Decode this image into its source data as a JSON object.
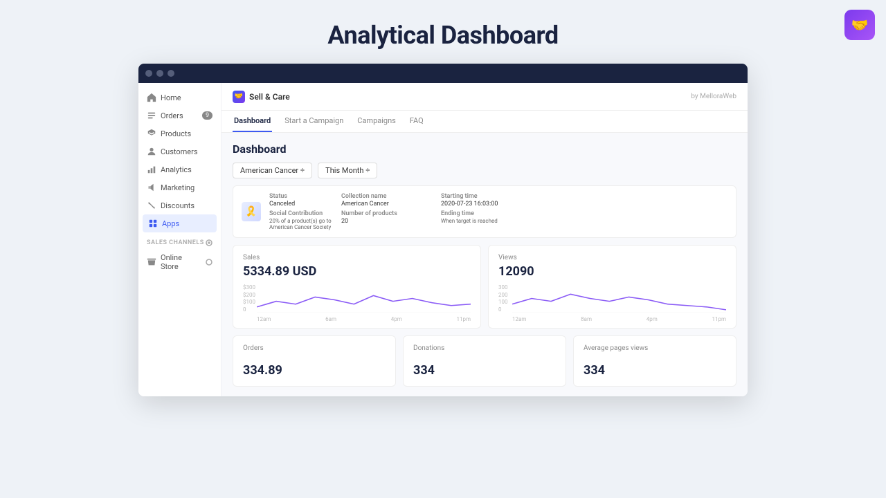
{
  "page": {
    "title": "Analytical Dashboard"
  },
  "topLogo": {
    "symbol": "🤝"
  },
  "browser": {
    "bar_color": "#1a2340"
  },
  "sidebar": {
    "nav_items": [
      {
        "id": "home",
        "label": "Home",
        "icon": "home",
        "active": false,
        "badge": null
      },
      {
        "id": "orders",
        "label": "Orders",
        "icon": "orders",
        "active": false,
        "badge": "9"
      },
      {
        "id": "products",
        "label": "Products",
        "icon": "products",
        "active": false,
        "badge": null
      },
      {
        "id": "customers",
        "label": "Customers",
        "icon": "customers",
        "active": false,
        "badge": null
      },
      {
        "id": "analytics",
        "label": "Analytics",
        "icon": "analytics",
        "active": false,
        "badge": null
      },
      {
        "id": "marketing",
        "label": "Marketing",
        "icon": "marketing",
        "active": false,
        "badge": null
      },
      {
        "id": "discounts",
        "label": "Discounts",
        "icon": "discounts",
        "active": false,
        "badge": null
      },
      {
        "id": "apps",
        "label": "Apps",
        "icon": "apps",
        "active": true,
        "badge": null
      }
    ],
    "sales_channels_label": "SALES CHANNELS",
    "channel_items": [
      {
        "id": "online-store",
        "label": "Online Store"
      }
    ]
  },
  "appHeader": {
    "brand": "Sell & Care",
    "by_text": "by MelloraWeb"
  },
  "tabs": [
    {
      "id": "dashboard",
      "label": "Dashboard",
      "active": true
    },
    {
      "id": "start-campaign",
      "label": "Start a Campaign",
      "active": false
    },
    {
      "id": "campaigns",
      "label": "Campaigns",
      "active": false
    },
    {
      "id": "faq",
      "label": "FAQ",
      "active": false
    }
  ],
  "dashboard": {
    "heading": "Dashboard",
    "filter_campaign": "American Cancer ÷",
    "filter_period": "This Month ÷",
    "campaign_card": {
      "status_label": "Status",
      "status_value": "Canceled",
      "type_label": "Social Contribution",
      "type_value": "20% of a product(s) go to American Cancer Society",
      "collection_label": "Collection name",
      "collection_value": "American Cancer",
      "products_label": "Number of products",
      "products_value": "20",
      "start_label": "Starting time",
      "start_value": "2020-07-23 16:03:00",
      "end_label": "Ending time",
      "end_value": "When target is reached"
    },
    "sales_card": {
      "label": "Sales",
      "value": "5334.89 USD",
      "y_labels": [
        "$300",
        "$200",
        "$100",
        "0"
      ],
      "x_labels": [
        "12am",
        "6am",
        "4pm",
        "11pm"
      ]
    },
    "views_card": {
      "label": "Views",
      "value": "12090",
      "y_labels": [
        "300",
        "200",
        "100",
        "0"
      ],
      "x_labels": [
        "12am",
        "8am",
        "4pm",
        "11pm"
      ]
    },
    "orders_card": {
      "label": "Orders",
      "value": "334.89"
    },
    "donations_card": {
      "label": "Donations",
      "value": "334"
    },
    "avg_pages_card": {
      "label": "Average pages views",
      "value": "334"
    }
  }
}
